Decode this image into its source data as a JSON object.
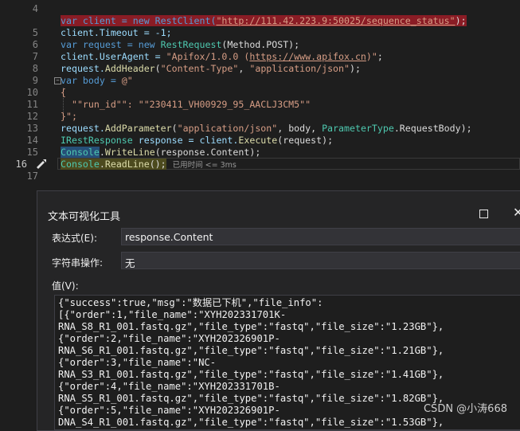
{
  "editor": {
    "line_numbers": [
      "4",
      "5",
      "6",
      "7",
      "8",
      "9",
      "10",
      "11",
      "12",
      "13",
      "14",
      "15",
      "16",
      "17"
    ],
    "line1_pre": "var client = new RestClient(",
    "line1_url": "\"http://111.42.223.9:50025/sequence_status\"",
    "line1_post": ");",
    "line2": "client.Timeout = -1;",
    "line3_a": "var request = new ",
    "line3_b": "RestRequest",
    "line3_c": "(Method.POST);",
    "line4_a": "client.UserAgent = ",
    "line4_b": "\"Apifox/1.0.0 (",
    "line4_link": "https://www.apifox.cn",
    "line4_c": ")\"",
    "line4_d": ";",
    "line5_a": "request.",
    "line5_b": "AddHeader",
    "line5_c": "(",
    "line5_d": "\"Content-Type\"",
    "line5_e": ", ",
    "line5_f": "\"application/json\"",
    "line5_g": ");",
    "line6_a": "var body = ",
    "line6_b": "@\"",
    "line7": "{",
    "line8": "  \"\"run_id\"\": \"\"230411_VH00929_95_AACLJ3CM5\"\"",
    "line9": "}\";",
    "line10_a": "request.",
    "line10_b": "AddParameter",
    "line10_c": "(",
    "line10_d": "\"application/json\"",
    "line10_e": ", body, ",
    "line10_f": "ParameterType",
    "line10_g": ".RequestBody);",
    "line11_a": "IRestResponse",
    "line11_b": " response = client.",
    "line11_c": "Execute",
    "line11_d": "(request);",
    "line12_a": "Console",
    "line12_b": ".",
    "line12_c": "WriteLine",
    "line12_d": "(response.Content);",
    "line13_a": "Console",
    "line13_b": ".",
    "line13_c": "ReadLine",
    "line13_d": "();",
    "elapsed": "已用时间 <= 3ms"
  },
  "dialog": {
    "title": "文本可视化工具",
    "expression_label": "表达式(E):",
    "expression_value": "response.Content",
    "string_op_label": "字符串操作:",
    "string_op_value": "无",
    "value_label": "值(V):",
    "value_lines": [
      "{\"success\":true,\"msg\":\"数据已下机\",\"file_info\":",
      "[{\"order\":1,\"file_name\":\"XYH202331701K-",
      "RNA_S8_R1_001.fastq.gz\",\"file_type\":\"fastq\",\"file_size\":\"1.23GB\"},",
      "{\"order\":2,\"file_name\":\"XYH202326901P-",
      "RNA_S6_R1_001.fastq.gz\",\"file_type\":\"fastq\",\"file_size\":\"1.21GB\"},",
      "{\"order\":3,\"file_name\":\"NC-",
      "RNA_S3_R1_001.fastq.gz\",\"file_type\":\"fastq\",\"file_size\":\"1.41GB\"},",
      "{\"order\":4,\"file_name\":\"XYH202331701B-",
      "RNA_S5_R1_001.fastq.gz\",\"file_type\":\"fastq\",\"file_size\":\"1.82GB\"},",
      "{\"order\":5,\"file_name\":\"XYH202326901P-",
      "DNA_S4_R1_001.fastq.gz\",\"file_type\":\"fastq\",\"file_size\":\"1.53GB\"},"
    ]
  },
  "watermark": "CSDN @小涛668",
  "icons": {
    "maximize": "maximize-icon",
    "close": "close-icon",
    "debug": "debug-arrow-icon"
  }
}
